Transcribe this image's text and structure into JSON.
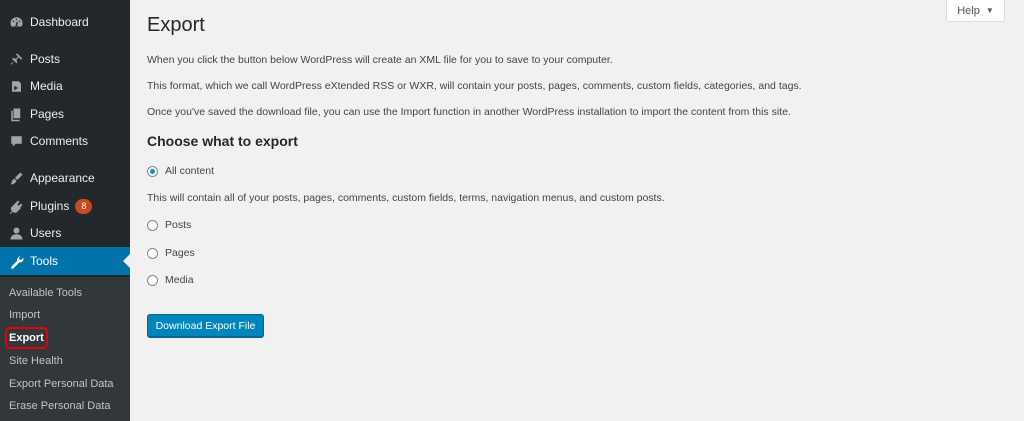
{
  "sidebar": {
    "items": [
      {
        "label": "Dashboard",
        "icon": "dashboard-icon"
      },
      {
        "label": "Posts",
        "icon": "pin-icon"
      },
      {
        "label": "Media",
        "icon": "media-icon"
      },
      {
        "label": "Pages",
        "icon": "pages-icon"
      },
      {
        "label": "Comments",
        "icon": "comment-icon"
      },
      {
        "label": "Appearance",
        "icon": "brush-icon"
      },
      {
        "label": "Plugins",
        "icon": "plugin-icon",
        "badge": "8"
      },
      {
        "label": "Users",
        "icon": "user-icon"
      },
      {
        "label": "Tools",
        "icon": "wrench-icon",
        "active": true
      }
    ],
    "submenu": [
      {
        "label": "Available Tools"
      },
      {
        "label": "Import"
      },
      {
        "label": "Export",
        "current": true
      },
      {
        "label": "Site Health"
      },
      {
        "label": "Export Personal Data"
      },
      {
        "label": "Erase Personal Data"
      }
    ]
  },
  "help": {
    "label": "Help"
  },
  "main": {
    "title": "Export",
    "paragraphs": [
      "When you click the button below WordPress will create an XML file for you to save to your computer.",
      "This format, which we call WordPress eXtended RSS or WXR, will contain your posts, pages, comments, custom fields, categories, and tags.",
      "Once you've saved the download file, you can use the Import function in another WordPress installation to import the content from this site."
    ],
    "section_title": "Choose what to export",
    "options": [
      {
        "label": "All content",
        "checked": true
      },
      {
        "label": "Posts",
        "checked": false
      },
      {
        "label": "Pages",
        "checked": false
      },
      {
        "label": "Media",
        "checked": false
      }
    ],
    "all_content_description": "This will contain all of your posts, pages, comments, custom fields, terms, navigation menus, and custom posts.",
    "download_button": "Download Export File"
  },
  "colors": {
    "sidebar_bg": "#23282d",
    "submenu_bg": "#32373c",
    "accent": "#0073aa",
    "button": "#0085ba",
    "badge": "#ca4a1f",
    "highlight_box": "#e3000f"
  }
}
